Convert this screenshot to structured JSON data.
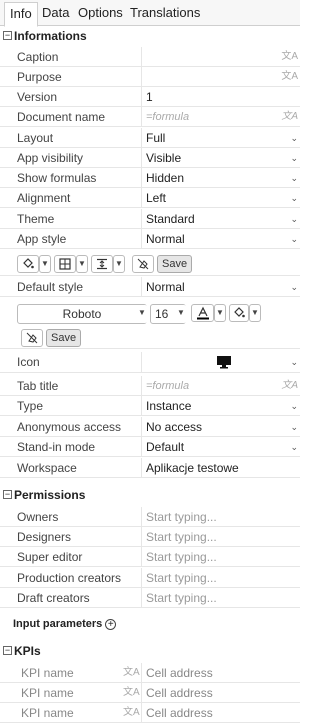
{
  "tabs": [
    "Info",
    "Data",
    "Options",
    "Translations"
  ],
  "informations": {
    "header": "Informations",
    "rows": [
      {
        "label": "Caption",
        "value": ""
      },
      {
        "label": "Purpose",
        "value": ""
      },
      {
        "label": "Version",
        "value": "1"
      },
      {
        "label": "Document name",
        "value": "=formula"
      },
      {
        "label": "Layout",
        "value": "Full"
      },
      {
        "label": "App visibility",
        "value": "Visible"
      },
      {
        "label": "Show formulas",
        "value": "Hidden"
      },
      {
        "label": "Alignment",
        "value": "Left"
      },
      {
        "label": "Theme",
        "value": "Standard"
      },
      {
        "label": "App style",
        "value": "Normal"
      }
    ],
    "toolbar": {
      "save_label": "Save"
    },
    "default_style": {
      "label": "Default style",
      "value": "Normal"
    },
    "font": {
      "family": "Roboto",
      "size": "16",
      "save_label": "Save"
    },
    "rows2": [
      {
        "label": "Icon",
        "value": ""
      },
      {
        "label": "Tab title",
        "value": "=formula"
      },
      {
        "label": "Type",
        "value": "Instance"
      },
      {
        "label": "Anonymous access",
        "value": "No access"
      },
      {
        "label": "Stand-in mode",
        "value": "Default"
      },
      {
        "label": "Workspace",
        "value": "Aplikacje testowe"
      }
    ]
  },
  "permissions": {
    "header": "Permissions",
    "rows": [
      {
        "label": "Owners",
        "value": "Start typing..."
      },
      {
        "label": "Designers",
        "value": "Start typing..."
      },
      {
        "label": "Super editor",
        "value": "Start typing..."
      },
      {
        "label": "Production creators",
        "value": "Start typing..."
      },
      {
        "label": "Draft creators",
        "value": "Start typing..."
      }
    ]
  },
  "input_parameters": {
    "label": "Input parameters"
  },
  "kpis": {
    "header": "KPIs",
    "rows": [
      {
        "name": "KPI name",
        "cell": "Cell address"
      },
      {
        "name": "KPI name",
        "cell": "Cell address"
      },
      {
        "name": "KPI name",
        "cell": "Cell address"
      }
    ]
  }
}
